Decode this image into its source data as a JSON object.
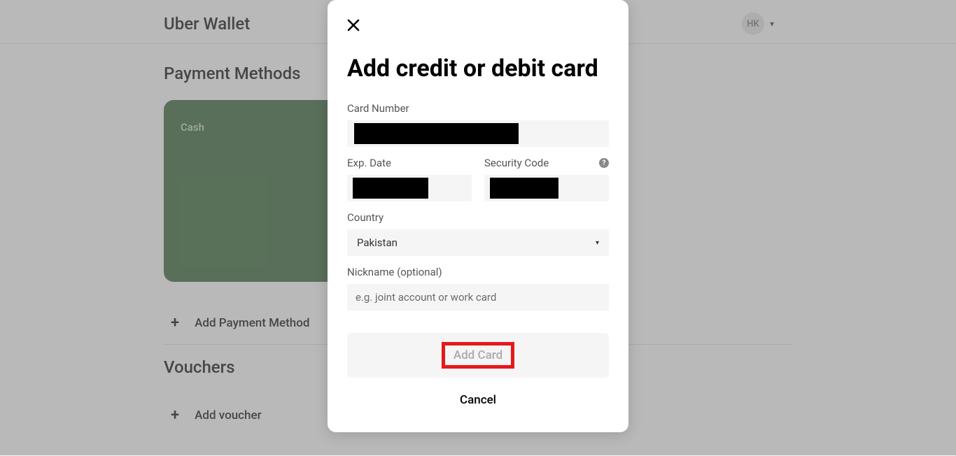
{
  "header": {
    "title": "Uber Wallet",
    "avatar_initials": "HK"
  },
  "sections": {
    "payment_title": "Payment Methods",
    "vouchers_title": "Vouchers"
  },
  "payment_card": {
    "label": "Cash"
  },
  "actions": {
    "add_payment": "Add Payment Method",
    "add_voucher": "Add voucher"
  },
  "modal": {
    "title": "Add credit or debit card",
    "labels": {
      "card_number": "Card Number",
      "exp_date": "Exp. Date",
      "security_code": "Security Code",
      "country": "Country",
      "nickname": "Nickname (optional)"
    },
    "country_value": "Pakistan",
    "nickname_placeholder": "e.g. joint account or work card",
    "add_card": "Add Card",
    "cancel": "Cancel"
  }
}
